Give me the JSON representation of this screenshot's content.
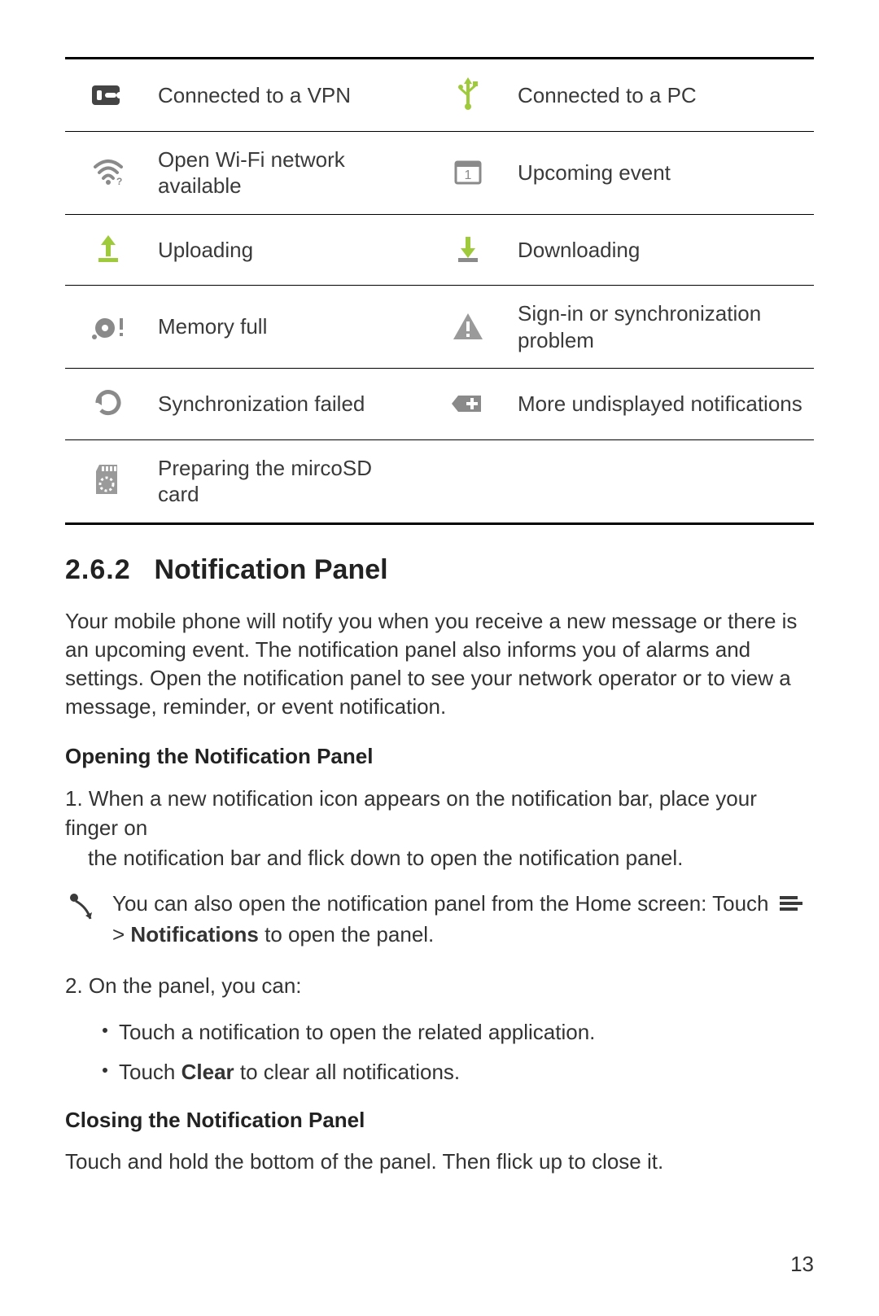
{
  "table": {
    "rows": [
      {
        "leftIcon": "vpn-icon",
        "leftLabel": "Connected to a VPN",
        "rightIcon": "usb-icon",
        "rightLabel": "Connected to a PC"
      },
      {
        "leftIcon": "wifi-open-icon",
        "leftLabel": "Open Wi-Fi network available",
        "rightIcon": "calendar-event-icon",
        "rightLabel": "Upcoming event"
      },
      {
        "leftIcon": "upload-icon",
        "leftLabel": "Uploading",
        "rightIcon": "download-icon",
        "rightLabel": "Downloading"
      },
      {
        "leftIcon": "memory-full-icon",
        "leftLabel": "Memory full",
        "rightIcon": "warning-icon",
        "rightLabel": "Sign-in or synchronization problem"
      },
      {
        "leftIcon": "sync-failed-icon",
        "leftLabel": "Synchronization failed",
        "rightIcon": "more-notifications-icon",
        "rightLabel": "More undisplayed notifications"
      },
      {
        "leftIcon": "sd-prepare-icon",
        "leftLabel": "Preparing the mircoSD card",
        "rightIcon": "",
        "rightLabel": ""
      }
    ]
  },
  "section": {
    "number": "2.6.2",
    "title": "Notification Panel",
    "intro": "Your mobile phone will notify you when you receive a new message or there is an upcoming event. The notification panel also informs you of alarms and settings. Open the notification panel to see your network operator or to view a message, reminder, or event notification.",
    "opening_head": "Opening the Notification Panel",
    "step1_lead": "1. When a new notification icon appears on the notification bar, place your finger on",
    "step1_cont": "the notification bar and flick down to open the notification panel.",
    "note_pre": "You can also open the notification panel from the Home screen: Touch ",
    "note_gt": " > ",
    "note_boldword": "Notifications",
    "note_post": " to open the panel.",
    "step2": "2. On the panel, you can:",
    "bullet1": "Touch a notification to open the related application.",
    "bullet2_pre": "Touch ",
    "bullet2_bold": "Clear",
    "bullet2_post": " to clear all notifications.",
    "closing_head": "Closing the Notification Panel",
    "closing_body": "Touch and hold the bottom of the panel. Then flick up to close it."
  },
  "page_number": "13"
}
